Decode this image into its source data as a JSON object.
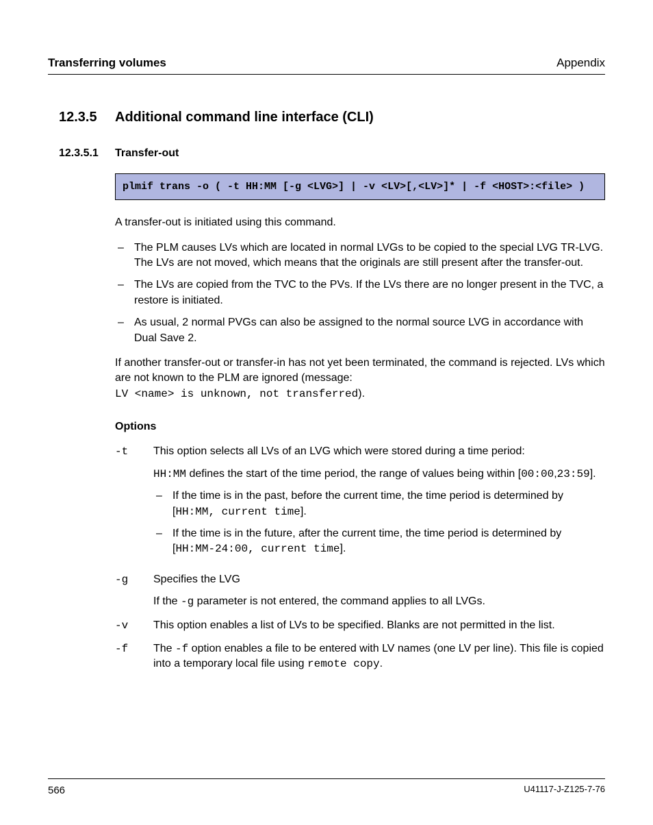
{
  "header": {
    "left": "Transferring volumes",
    "right": "Appendix"
  },
  "section": {
    "number": "12.3.5",
    "title": "Additional command line interface (CLI)"
  },
  "subsection": {
    "number": "12.3.5.1",
    "title": "Transfer-out"
  },
  "codebox": "plmif trans -o ( -t HH:MM [-g <LVG>] | -v <LV>[,<LV>]* | -f <HOST>:<file> )",
  "intro": "A transfer-out is initiated using this command.",
  "bullets": [
    "The PLM causes LVs which are located in normal LVGs to be copied to the special LVG TR-LVG. The LVs are not moved, which means that the originals are still present after the transfer-out.",
    "The LVs are copied from the TVC to the PVs. If the LVs there are no longer present in the TVC, a restore is initiated.",
    "As usual, 2 normal PVGs can also be assigned to the normal source LVG in accordance with Dual Save 2."
  ],
  "rejected": {
    "line1": "If another transfer-out or transfer-in has not yet been terminated, the command is rejected. LVs which are not known to the PLM are ignored (message:",
    "mono": "LV <name> is unknown, not transferred",
    "line2_tail": ")."
  },
  "options_heading": "Options",
  "options": {
    "t": {
      "flag": "-t",
      "desc": "This option selects all LVs of an LVG which were stored during a time period:",
      "hhmm_pre": "HH:MM",
      "hhmm_mid": " defines the start of the time period, the range of values being within [",
      "hhmm_r1": "00:00",
      "hhmm_sep": ",",
      "hhmm_r2": "23:59",
      "hhmm_tail": "].",
      "nested": [
        {
          "pre": "If the time is in the past, before the current time, the time period is determined by [",
          "mono": "HH:MM, current time",
          "tail": "]."
        },
        {
          "pre": "If the time is in the future, after the current time, the time period is determined by [",
          "mono": "HH:MM-24:00, current time",
          "tail": "]."
        }
      ]
    },
    "g": {
      "flag": "-g",
      "desc": "Specifies the LVG",
      "sub_pre": "If the ",
      "sub_mono": "-g",
      "sub_tail": " parameter  is not entered, the command applies to all LVGs."
    },
    "v": {
      "flag": "-v",
      "desc": "This option enables a list of LVs to be specified. Blanks are not permitted in the list."
    },
    "f": {
      "flag": "-f",
      "pre": "The ",
      "mono1": "-f",
      "mid": " option enables a file to be entered with LV names (one LV per line). This file is copied into a temporary local file using ",
      "mono2": "remote copy",
      "tail": "."
    }
  },
  "footer": {
    "page": "566",
    "docid": "U41117-J-Z125-7-76"
  }
}
